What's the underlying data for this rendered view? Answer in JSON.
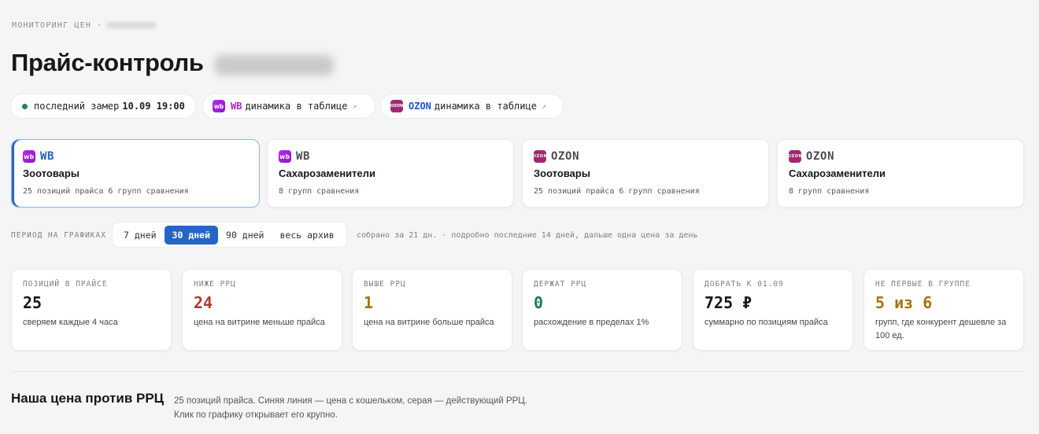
{
  "header": {
    "breadcrumb": "МОНИТОРИНГ ЦЕН ·",
    "title": "Прайс-контроль"
  },
  "status_pills": {
    "last_measure_label": "последний замер",
    "last_measure_value": "10.09 19:00",
    "wb_marketplace": "WB",
    "wb_link": "динамика в таблице",
    "ozon_marketplace": "OZON",
    "ozon_link": "динамика в таблице",
    "arrow_glyph": "↗"
  },
  "logos": {
    "wb": "wb",
    "ozon": "OZON"
  },
  "selected_card": 0,
  "cards": [
    {
      "marketplace": "WB",
      "name": "Зоотовары",
      "meta": "25 позиций прайса  6 групп сравнения"
    },
    {
      "marketplace": "WB",
      "name": "Сахарозаменители",
      "meta": "8 групп сравнения"
    },
    {
      "marketplace": "OZON",
      "name": "Зоотовары",
      "meta": "25 позиций прайса  6 групп сравнения"
    },
    {
      "marketplace": "OZON",
      "name": "Сахарозаменители",
      "meta": "8 групп сравнения"
    }
  ],
  "period": {
    "label": "ПЕРИОД НА ГРАФИКАХ",
    "options": [
      "7 дней",
      "30 дней",
      "90 дней",
      "весь архив"
    ],
    "selected": "30 дней",
    "note": "собрано за 21 дн. · подробно последние 14 дней, дальше одна цена за день"
  },
  "stats": [
    {
      "label": "ПОЗИЦИЙ В ПРАЙСЕ",
      "value": "25",
      "desc": "сверяем каждые 4 часа",
      "color": "#15171a"
    },
    {
      "label": "НИЖЕ РРЦ",
      "value": "24",
      "desc": "цена на витрине меньше прайса",
      "color": "#b03a2e"
    },
    {
      "label": "ВЫШЕ РРЦ",
      "value": "1",
      "desc": "цена на витрине больше прайса",
      "color": "#a5740f"
    },
    {
      "label": "ДЕРЖАТ РРЦ",
      "value": "0",
      "desc": "расхождение в пределах 1%",
      "color": "#1e7a4a"
    },
    {
      "label": "ДОБРАТЬ К 01.09",
      "value": "725 ₽",
      "desc": "суммарно по позициям прайса",
      "color": "#15171a"
    },
    {
      "label": "НЕ ПЕРВЫЕ В ГРУППЕ",
      "value": "5 из 6",
      "desc": "групп, где конкурент дешевле за 100 ед.",
      "color": "#a5740f"
    }
  ],
  "section": {
    "title": "Наша цена против РРЦ",
    "desc": "25 позиций прайса. Синяя линия — цена с кошельком, серая — действующий РРЦ. Клик по графику открывает его крупно."
  },
  "colors": {
    "accent": "#2566c4",
    "wb": "#a625d8",
    "ozon": "#a4266f"
  }
}
